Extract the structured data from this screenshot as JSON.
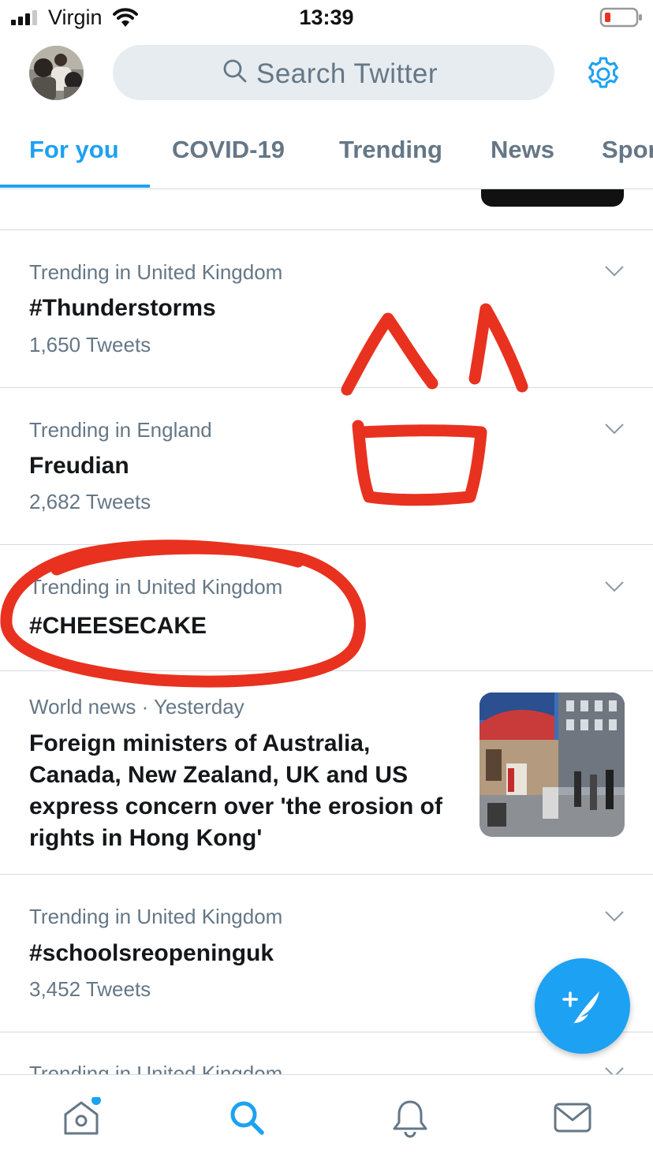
{
  "status_bar": {
    "carrier": "Virgin",
    "time": "13:39"
  },
  "header": {
    "search_placeholder": "Search Twitter"
  },
  "tabs": [
    {
      "label": "For you",
      "active": true
    },
    {
      "label": "COVID-19",
      "active": false
    },
    {
      "label": "Trending",
      "active": false
    },
    {
      "label": "News",
      "active": false
    },
    {
      "label": "Spor",
      "active": false
    }
  ],
  "feed": {
    "items": [
      {
        "context": "Trending in United Kingdom",
        "title": "#Thunderstorms",
        "count": "1,650 Tweets"
      },
      {
        "context": "Trending in England",
        "title": "Freudian",
        "count": "2,682 Tweets"
      },
      {
        "context": "Trending in United Kingdom",
        "title": "#CHEESECAKE"
      },
      {
        "context": "Trending in United Kingdom",
        "title": "#schoolsreopeninguk",
        "count": "3,452 Tweets"
      },
      {
        "context": "Trending in United Kingdom"
      }
    ],
    "news": {
      "context": "World news · Yesterday",
      "title": "Foreign ministers of Australia, Canada, New Zealand, UK and US express concern over 'the erosion of rights in Hong Kong'"
    }
  },
  "icons": {
    "header": [
      "avatar",
      "search-icon",
      "settings-gear-icon"
    ],
    "bottom_nav": [
      "home-icon",
      "search-icon",
      "notifications-bell-icon",
      "messages-envelope-icon"
    ],
    "fab": "compose-tweet-icon"
  },
  "colors": {
    "accent": "#1da1f2",
    "doodle": "#e8321f",
    "secondary_text": "#657786"
  }
}
